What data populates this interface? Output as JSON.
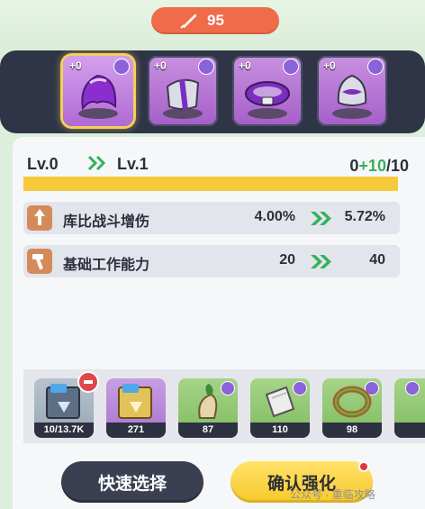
{
  "currency": {
    "icon": "quill-icon",
    "value": "95"
  },
  "equipment": [
    {
      "name": "purple-helmet",
      "plus": "+0",
      "selected": true
    },
    {
      "name": "purple-armor",
      "plus": "+0",
      "selected": false
    },
    {
      "name": "purple-belt",
      "plus": "+0",
      "selected": false
    },
    {
      "name": "purple-mask",
      "plus": "+0",
      "selected": false
    }
  ],
  "level": {
    "from": "Lv.0",
    "to": "Lv.1",
    "exp_current": "0",
    "exp_gain": "+10",
    "exp_max": "/10",
    "progress_fraction": 1.0
  },
  "stats": [
    {
      "icon": "damage-up-icon",
      "name": "库比战斗增伤",
      "from": "4.00%",
      "to": "5.72%"
    },
    {
      "icon": "hammer-icon",
      "name": "基础工作能力",
      "from": "20",
      "to": "40"
    }
  ],
  "materials": [
    {
      "name": "exp-book-gray",
      "count": "10/13.7K",
      "style": "gray",
      "removable": true
    },
    {
      "name": "exp-book-purple",
      "count": "271",
      "style": "purple"
    },
    {
      "name": "carrot-material",
      "count": "87",
      "style": "green",
      "flame": true
    },
    {
      "name": "bandage-material",
      "count": "110",
      "style": "green",
      "flame": true
    },
    {
      "name": "ring-material",
      "count": "98",
      "style": "green",
      "flame": true
    },
    {
      "name": "partial-material",
      "count": "",
      "style": "green",
      "flame": true
    }
  ],
  "buttons": {
    "quick_select": "快速选择",
    "confirm": "确认强化"
  },
  "watermark": "公众号 · 重临攻略",
  "colors": {
    "accent_yellow": "#f6c939",
    "exp_gain_green": "#36b05b",
    "currency_red": "#ef6b4a",
    "equip_purple": "#a55fc8",
    "strip_dark": "#2f3447"
  }
}
